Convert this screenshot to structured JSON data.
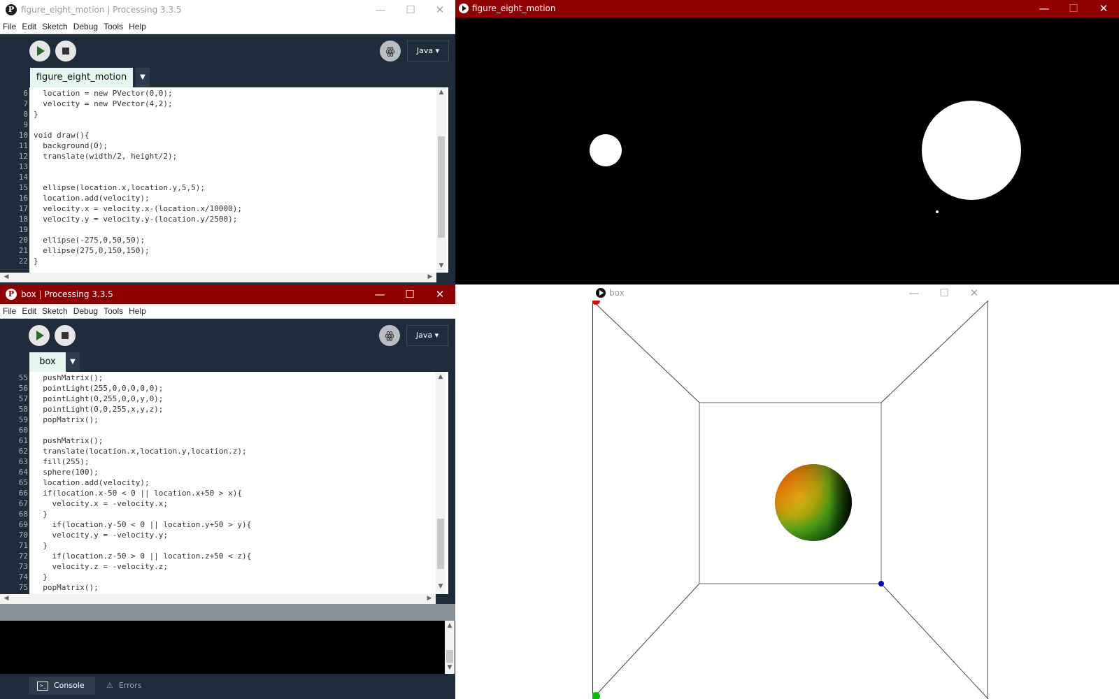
{
  "ide1": {
    "title": "figure_eight_motion | Processing 3.3.5",
    "menu": [
      "File",
      "Edit",
      "Sketch",
      "Debug",
      "Tools",
      "Help"
    ],
    "mode": "Java ▾",
    "tab": "figure_eight_motion",
    "tab_arrow": "▼",
    "code": [
      {
        "n": "6",
        "t": "  location = new PVector(0,0);"
      },
      {
        "n": "7",
        "t": "  velocity = new PVector(4,2);"
      },
      {
        "n": "8",
        "t": "}"
      },
      {
        "n": "9",
        "t": ""
      },
      {
        "n": "10",
        "t": "void draw(){"
      },
      {
        "n": "11",
        "t": "  background(0);"
      },
      {
        "n": "12",
        "t": "  translate(width/2, height/2);"
      },
      {
        "n": "13",
        "t": ""
      },
      {
        "n": "14",
        "t": ""
      },
      {
        "n": "15",
        "t": "  ellipse(location.x,location.y,5,5);"
      },
      {
        "n": "16",
        "t": "  location.add(velocity);"
      },
      {
        "n": "17",
        "t": "  velocity.x = velocity.x-(location.x/10000);"
      },
      {
        "n": "18",
        "t": "  velocity.y = velocity.y-(location.y/2500);"
      },
      {
        "n": "19",
        "t": ""
      },
      {
        "n": "20",
        "t": "  ellipse(-275,0,50,50);"
      },
      {
        "n": "21",
        "t": "  ellipse(275,0,150,150);"
      },
      {
        "n": "22",
        "t": "}"
      }
    ]
  },
  "ide2": {
    "title": "box | Processing 3.3.5",
    "menu": [
      "File",
      "Edit",
      "Sketch",
      "Debug",
      "Tools",
      "Help"
    ],
    "mode": "Java ▾",
    "tab": "box",
    "tab_arrow": "▼",
    "code": [
      {
        "n": "55",
        "t": "  pushMatrix();"
      },
      {
        "n": "56",
        "t": "  pointLight(255,0,0,0,0,0);"
      },
      {
        "n": "57",
        "t": "  pointLight(0,255,0,0,y,0);"
      },
      {
        "n": "58",
        "t": "  pointLight(0,0,255,x,y,z);"
      },
      {
        "n": "59",
        "t": "  popMatrix();"
      },
      {
        "n": "60",
        "t": ""
      },
      {
        "n": "61",
        "t": "  pushMatrix();"
      },
      {
        "n": "62",
        "t": "  translate(location.x,location.y,location.z);"
      },
      {
        "n": "63",
        "t": "  fill(255);"
      },
      {
        "n": "64",
        "t": "  sphere(100);"
      },
      {
        "n": "65",
        "t": "  location.add(velocity);"
      },
      {
        "n": "66",
        "t": "  if(location.x-50 < 0 || location.x+50 > x){"
      },
      {
        "n": "67",
        "t": "    velocity.x = -velocity.x;"
      },
      {
        "n": "68",
        "t": "  }"
      },
      {
        "n": "69",
        "t": "    if(location.y-50 < 0 || location.y+50 > y){"
      },
      {
        "n": "70",
        "t": "    velocity.y = -velocity.y;"
      },
      {
        "n": "71",
        "t": "  }"
      },
      {
        "n": "72",
        "t": "    if(location.z-50 > 0 || location.z+50 < z){"
      },
      {
        "n": "73",
        "t": "    velocity.z = -velocity.z;"
      },
      {
        "n": "74",
        "t": "  }"
      },
      {
        "n": "75",
        "t": "  popMatrix();"
      }
    ],
    "footer": {
      "console": "Console",
      "errors": "Errors"
    }
  },
  "sketch1": {
    "title": "figure_eight_motion",
    "titlebar_color": "#8f0000"
  },
  "sketch2": {
    "title": "box"
  },
  "window_controls": {
    "minimize": "—",
    "maximize": "☐",
    "close": "✕"
  },
  "icons": {
    "ide_logo": "processing-logo-icon",
    "debug": "butterfly-debug-icon"
  },
  "colors": {
    "accent_red": "#8f0000",
    "ide_dark": "#1e2c3b",
    "tab_bg": "#e6f7ef"
  }
}
